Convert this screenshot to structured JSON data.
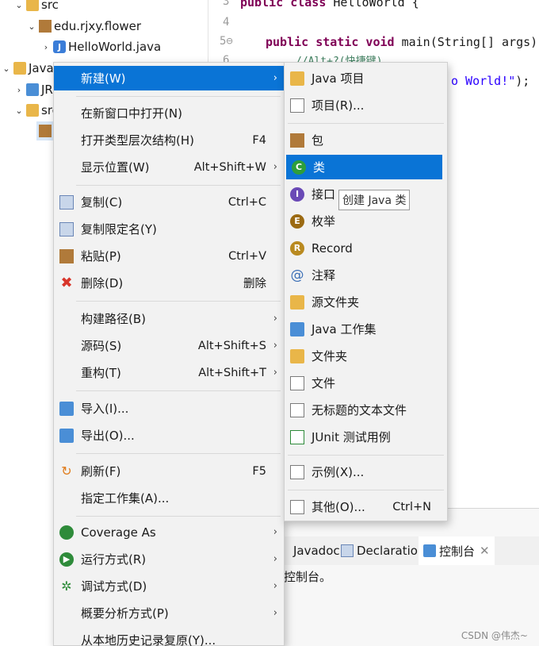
{
  "explorer": {
    "rows": [
      {
        "label": "src",
        "indent": 1
      },
      {
        "label": "edu.rjxy.flower",
        "indent": 2
      },
      {
        "label": "HelloWorld.java",
        "indent": 3
      },
      {
        "label": "Java p",
        "indent": 0
      },
      {
        "label": "JRI",
        "indent": 1
      },
      {
        "label": "src",
        "indent": 1
      }
    ]
  },
  "editor": {
    "line_numbers": [
      "3",
      "4",
      "5⊖",
      "6"
    ],
    "line3": {
      "kw": "public class",
      "rest": " HelloWorld {"
    },
    "line5": {
      "kw": "public static void",
      "rest": " main(String[] args) {"
    },
    "line6": {
      "comment": "//Alt+?(快捷键)"
    },
    "line7": {
      "str": "o World!\"",
      "rest": ");"
    }
  },
  "bottom_panel": {
    "tabs": [
      "Javadoc",
      "Declaration",
      "控制台"
    ],
    "console_text": "控制台。",
    "watermark": "CSDN @伟杰~"
  },
  "context_menu": {
    "items": [
      {
        "label": "新建(W)",
        "accel": "",
        "submenu": true,
        "selected": true
      },
      {
        "label": "在新窗口中打开(N)",
        "accel": ""
      },
      {
        "label": "打开类型层次结构(H)",
        "accel": "F4"
      },
      {
        "label": "显示位置(W)",
        "accel": "Alt+Shift+W",
        "submenu": true
      },
      {
        "label": "复制(C)",
        "accel": "Ctrl+C"
      },
      {
        "label": "复制限定名(Y)",
        "accel": ""
      },
      {
        "label": "粘贴(P)",
        "accel": "Ctrl+V"
      },
      {
        "label": "删除(D)",
        "accel": "删除"
      },
      {
        "label": "构建路径(B)",
        "accel": "",
        "submenu": true
      },
      {
        "label": "源码(S)",
        "accel": "Alt+Shift+S",
        "submenu": true
      },
      {
        "label": "重构(T)",
        "accel": "Alt+Shift+T",
        "submenu": true
      },
      {
        "label": "导入(I)...",
        "accel": ""
      },
      {
        "label": "导出(O)...",
        "accel": ""
      },
      {
        "label": "刷新(F)",
        "accel": "F5"
      },
      {
        "label": "指定工作集(A)...",
        "accel": ""
      },
      {
        "label": "Coverage As",
        "accel": "",
        "submenu": true
      },
      {
        "label": "运行方式(R)",
        "accel": "",
        "submenu": true
      },
      {
        "label": "调试方式(D)",
        "accel": "",
        "submenu": true
      },
      {
        "label": "概要分析方式(P)",
        "accel": "",
        "submenu": true
      },
      {
        "label": "从本地历史记录复原(Y)...",
        "accel": ""
      }
    ]
  },
  "submenu": {
    "items": [
      {
        "label": "Java 项目"
      },
      {
        "label": "项目(R)..."
      },
      {
        "label": "包"
      },
      {
        "label": "类",
        "selected": true
      },
      {
        "label": "接口"
      },
      {
        "label": "枚举"
      },
      {
        "label": "Record"
      },
      {
        "label": "注释"
      },
      {
        "label": "源文件夹"
      },
      {
        "label": "Java 工作集"
      },
      {
        "label": "文件夹"
      },
      {
        "label": "文件"
      },
      {
        "label": "无标题的文本文件"
      },
      {
        "label": "JUnit 测试用例"
      },
      {
        "label": "示例(X)..."
      },
      {
        "label": "其他(O)...",
        "accel": "Ctrl+N"
      }
    ],
    "tooltip": "创建 Java 类"
  },
  "colors": {
    "selection": "#0a74d6",
    "menu_bg": "#f2f2f2",
    "keyword": "#7f0055",
    "string": "#2a00ff",
    "comment": "#3f7f5f"
  }
}
